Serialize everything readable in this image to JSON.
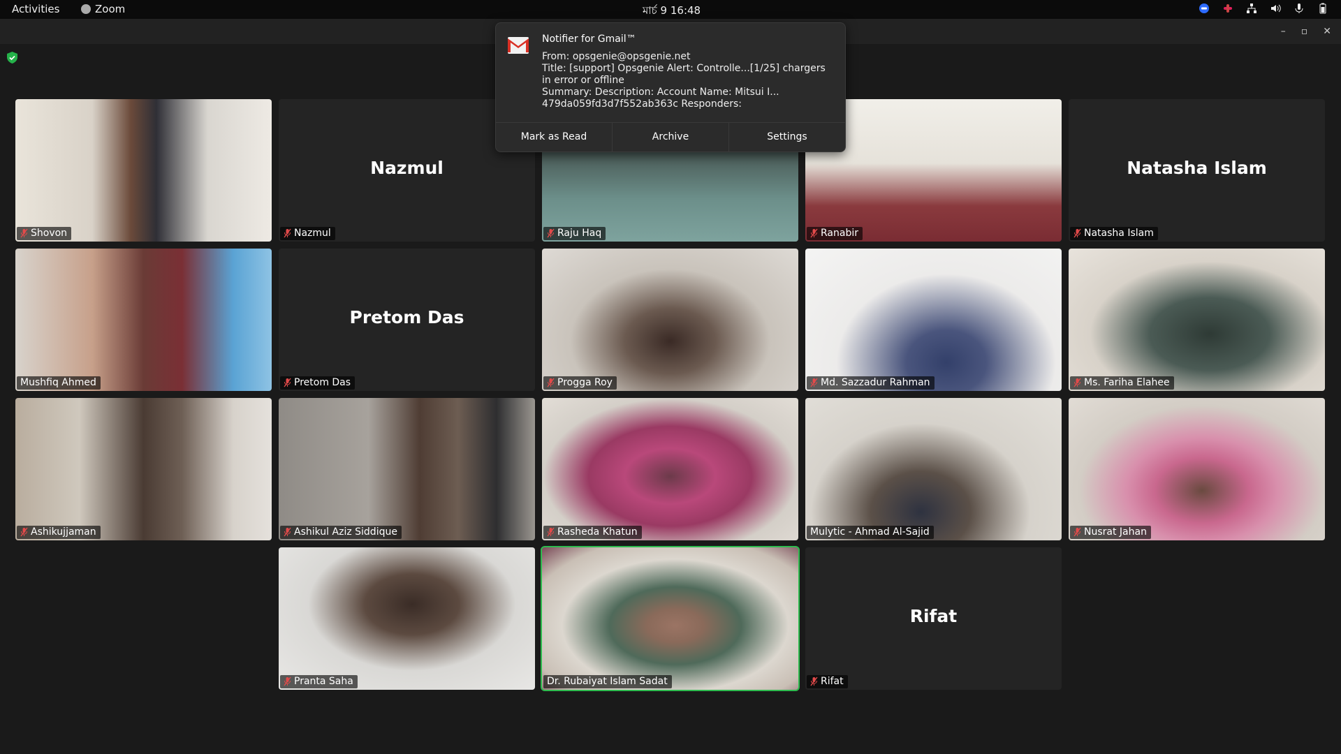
{
  "topbar": {
    "activities": "Activities",
    "app_name": "Zoom",
    "clock": "মার্চ 9  16:48",
    "tray_icons": [
      "zoom-tray-icon",
      "slack-tray-icon",
      "network-icon",
      "volume-icon",
      "microphone-icon",
      "battery-icon"
    ]
  },
  "window": {
    "controls": {
      "minimize": "–",
      "maximize": "▫",
      "close": "✕"
    }
  },
  "notification": {
    "app_title": "Notifier for Gmail™",
    "from": "From: opsgenie@opsgenie.net",
    "title_line": "Title: [support] Opsgenie Alert: Controlle...[1/25] chargers in error or offline",
    "summary": "Summary: Description: Account Name: Mitsui I...\n479da059fd3d7f552ab363c Responders:",
    "actions": {
      "mark_read": "Mark as Read",
      "archive": "Archive",
      "settings": "Settings"
    }
  },
  "participants": [
    {
      "name": "Shovon",
      "video": true,
      "muted": true
    },
    {
      "name": "Nazmul",
      "video": false,
      "muted": true
    },
    {
      "name": "Raju Haq",
      "video": true,
      "muted": true
    },
    {
      "name": "Ranabir",
      "video": true,
      "muted": true
    },
    {
      "name": "Natasha Islam",
      "video": false,
      "muted": true
    },
    {
      "name": "Mushfiq Ahmed",
      "video": true,
      "muted": false
    },
    {
      "name": "Pretom Das",
      "video": false,
      "muted": true
    },
    {
      "name": "Progga Roy",
      "video": true,
      "muted": true
    },
    {
      "name": "Md. Sazzadur Rahman",
      "video": true,
      "muted": true
    },
    {
      "name": "Ms. Fariha Elahee",
      "video": true,
      "muted": true
    },
    {
      "name": "Ashikujjaman",
      "video": true,
      "muted": true
    },
    {
      "name": "Ashikul Aziz Siddique",
      "video": true,
      "muted": true
    },
    {
      "name": "Rasheda Khatun",
      "video": true,
      "muted": true
    },
    {
      "name": "Mulytic - Ahmad Al-Sajid",
      "video": true,
      "muted": false
    },
    {
      "name": "Nusrat Jahan",
      "video": true,
      "muted": true
    },
    {
      "name": "Pranta Saha",
      "video": true,
      "muted": true
    },
    {
      "name": "Dr. Rubaiyat Islam Sadat",
      "video": true,
      "muted": false,
      "active_speaker": true
    },
    {
      "name": "Rifat",
      "video": false,
      "muted": true
    }
  ]
}
